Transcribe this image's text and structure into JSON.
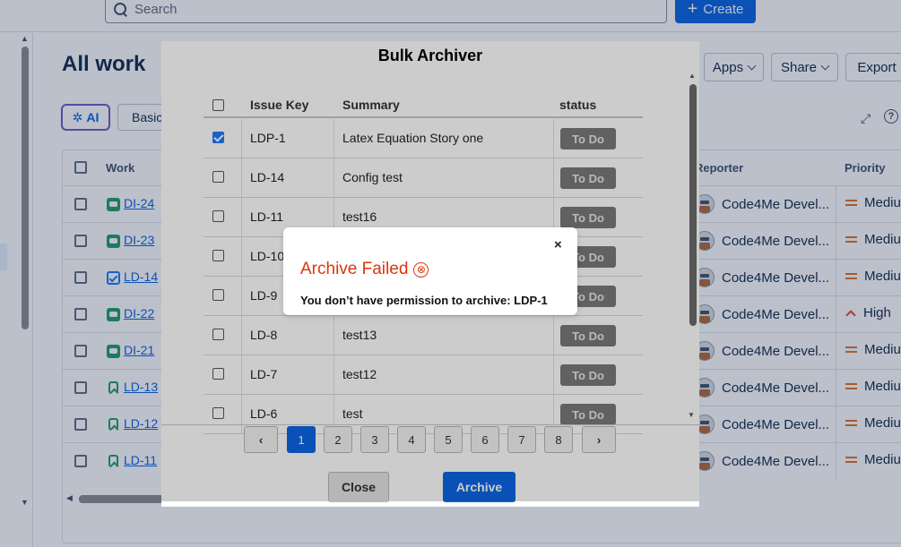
{
  "search": {
    "placeholder": "Search"
  },
  "create": {
    "label": "Create"
  },
  "page": {
    "title": "All work"
  },
  "filters": {
    "ai_label": "AI",
    "basic_label": "Basic"
  },
  "header_buttons": {
    "apps": "Apps",
    "share": "Share",
    "export": "Export"
  },
  "columns": {
    "work": "Work",
    "reporter": "Reporter",
    "priority": "Priority"
  },
  "work_rows": [
    {
      "key": "DI-24",
      "type": "story",
      "reporter": "Code4Me Devel...",
      "priority": "Mediu",
      "priority_level": "medium"
    },
    {
      "key": "DI-23",
      "type": "story",
      "reporter": "Code4Me Devel...",
      "priority": "Mediu",
      "priority_level": "medium"
    },
    {
      "key": "LD-14",
      "type": "task",
      "reporter": "Code4Me Devel...",
      "priority": "Mediu",
      "priority_level": "medium"
    },
    {
      "key": "DI-22",
      "type": "story",
      "reporter": "Code4Me Devel...",
      "priority": "High",
      "priority_level": "high"
    },
    {
      "key": "DI-21",
      "type": "story",
      "reporter": "Code4Me Devel...",
      "priority": "Mediu",
      "priority_level": "medium"
    },
    {
      "key": "LD-13",
      "type": "bookmark",
      "reporter": "Code4Me Devel...",
      "priority": "Mediu",
      "priority_level": "medium"
    },
    {
      "key": "LD-12",
      "type": "bookmark",
      "reporter": "Code4Me Devel...",
      "priority": "Mediu",
      "priority_level": "medium"
    },
    {
      "key": "LD-11",
      "type": "bookmark",
      "reporter": "Code4Me Devel...",
      "priority": "Mediu",
      "priority_level": "medium"
    }
  ],
  "bulk_archiver": {
    "title": "Bulk Archiver",
    "columns": {
      "issue_key": "Issue Key",
      "summary": "Summary",
      "status": "status"
    },
    "rows": [
      {
        "key": "LDP-1",
        "summary": "Latex Equation Story one",
        "status": "To Do",
        "checked": true
      },
      {
        "key": "LD-14",
        "summary": "Config test",
        "status": "To Do",
        "checked": false
      },
      {
        "key": "LD-11",
        "summary": "test16",
        "status": "To Do",
        "checked": false
      },
      {
        "key": "LD-10",
        "summary": "",
        "status": "To Do",
        "checked": false
      },
      {
        "key": "LD-9",
        "summary": "",
        "status": "To Do",
        "checked": false
      },
      {
        "key": "LD-8",
        "summary": "test13",
        "status": "To Do",
        "checked": false
      },
      {
        "key": "LD-7",
        "summary": "test12",
        "status": "To Do",
        "checked": false
      },
      {
        "key": "LD-6",
        "summary": "test",
        "status": "To Do",
        "checked": false
      }
    ],
    "pagination": {
      "prev": "‹",
      "pages": [
        "1",
        "2",
        "3",
        "4",
        "5",
        "6",
        "7",
        "8"
      ],
      "active": "1",
      "next": "›"
    },
    "close_label": "Close",
    "archive_label": "Archive"
  },
  "error_dialog": {
    "title": "Archive Failed",
    "icon": "⊗",
    "message": "You don’t have permission to archive: LDP-1",
    "close": "×"
  },
  "colors": {
    "accent": "#0c66e4",
    "error": "#de350b",
    "story": "#22a06b",
    "priority_medium": "#e2742f",
    "priority_high": "#e34935"
  }
}
